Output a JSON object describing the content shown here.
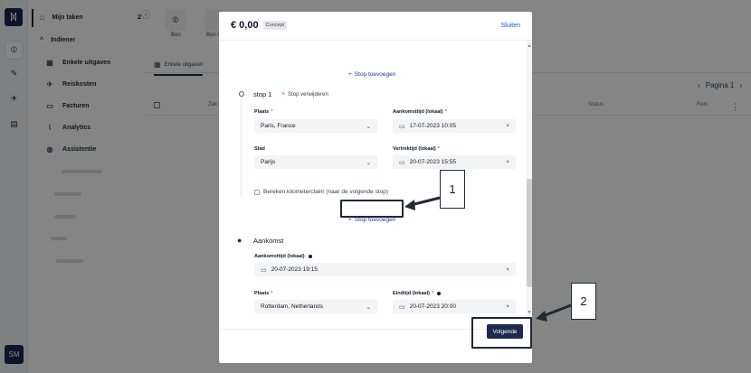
{
  "rail": {
    "logo": "ᛞ",
    "avatar": "SM",
    "items": [
      {
        "icon": "paperclip-icon",
        "glyph": "⦷"
      },
      {
        "icon": "edit-receipt-icon",
        "glyph": "✎"
      },
      {
        "icon": "plane-icon",
        "glyph": "✈"
      },
      {
        "icon": "document-icon",
        "glyph": "▤"
      }
    ]
  },
  "sidebar": {
    "home_label": "Mijn taken",
    "home_count": "2",
    "section_label": "Indiener",
    "items": [
      {
        "label": "Enkele uitgaven",
        "icon": "receipt-icon",
        "glyph": "▦"
      },
      {
        "label": "Reiskosten",
        "icon": "plane-icon",
        "glyph": "✈"
      },
      {
        "label": "Facturen",
        "icon": "invoice-icon",
        "glyph": "▭"
      },
      {
        "label": "Analytics",
        "icon": "chart-line-icon",
        "glyph": "⌇"
      },
      {
        "label": "Assistentie",
        "icon": "globe-icon",
        "glyph": "◍"
      }
    ]
  },
  "main": {
    "cards": [
      {
        "label": "Bon",
        "icon": "paperclip-icon",
        "glyph": "⦷"
      },
      {
        "label": "Bon o"
      }
    ],
    "tab_label": "Enkele uitgaven",
    "pagination_label": "Pagina 1",
    "columns": [
      "Zak",
      "Status",
      "Reis"
    ]
  },
  "modal": {
    "amount": "€ 0,00",
    "status_badge": "Concept",
    "close_label": "Sluiten",
    "add_stop_label": "Stop toevoegen",
    "stop": {
      "title": "stop 1",
      "remove_label": "Stop verwijderen",
      "place_label": "Plaats",
      "place_value": "Paris, France",
      "arrival_time_label": "Aankomsttijd (lokaal)",
      "arrival_time_value": "17-07-2023 10:05",
      "city_label": "Stad",
      "city_value": "Parijs",
      "departure_time_label": "Vertrektijd (lokaal)",
      "departure_time_value": "20-07-2023 15:55",
      "km_claim_label": "Bereken kilometerclaim (naar de volgende stop)"
    },
    "arrival": {
      "title": "Aankomst",
      "arrival_time_label": "Aankomsttijd (lokaal)",
      "arrival_time_value": "20-07-2023 19:15",
      "place_label": "Plaats",
      "place_value": "Rotterdam, Netherlands",
      "end_time_label": "Eindtijd (lokaal)",
      "end_time_value": "20-07-2023 20:00"
    },
    "next_label": "Volgende"
  },
  "annotations": {
    "callout_1": "1",
    "callout_2": "2"
  },
  "glyphs": {
    "plus": "+",
    "close": "×",
    "chevron_down": "⌄",
    "calendar": "▭",
    "pin": "●"
  }
}
